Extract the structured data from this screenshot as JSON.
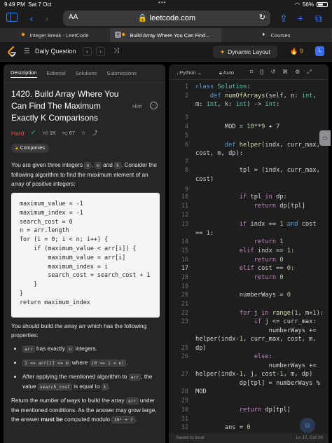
{
  "status_bar": {
    "time": "9:49 PM",
    "date": "Sat 7 Oct",
    "battery": "56%",
    "battery_level": 0.56
  },
  "browser": {
    "aa_label": "AA",
    "url": "leetcode.com",
    "tabs": [
      {
        "title": "Integer Break - LeetCode",
        "active": false
      },
      {
        "title": "Build Array Where You Can Find...",
        "active": true
      },
      {
        "title": "Courses",
        "active": false
      }
    ]
  },
  "lc_nav": {
    "daily_label": "Daily Question",
    "layout_label": "Dynamic Layout",
    "streak": "9"
  },
  "left_panel": {
    "tabs": [
      "Description",
      "Editorial",
      "Solutions",
      "Submissions"
    ],
    "title": "1420. Build Array Where You Can Find The Maximum Exactly K Comparisons",
    "hint": "Hint",
    "difficulty": "Hard",
    "likes": "1K",
    "dislikes": "67",
    "companies": "Companies",
    "intro_1": "You are given three integers",
    "n": "n",
    "m": "m",
    "k": "k",
    "intro_2": ". Consider the following algorithm to find the maximum element of an array of positive integers:",
    "algorithm": [
      "maximum_value = -1",
      "maximum_index = -1",
      "search_cost = 0",
      "n = arr.length",
      "for (i = 0; i < n; i++) {",
      "    if (maximum_value < arr[i]) {",
      "        maximum_value = arr[i]",
      "        maximum_index = i",
      "        search_cost = search_cost + 1",
      "    }",
      "}",
      "return maximum_index"
    ],
    "build_intro": "You should build the array arr which has the following properties:",
    "bullet_1_pre": "",
    "arr": "arr",
    "bullet_1_post": "has exactly",
    "bullet_1_end": "integers.",
    "range_code": "1 <= arr[i] <= m",
    "where": "where",
    "idx_code": "(0 <= i < n)",
    "bullet_3_pre": "After applying the mentioned algorithm to",
    "bullet_3_mid": ", the value",
    "search_cost": "search_cost",
    "bullet_3_end": "is equal to",
    "return_text_1": "Return the",
    "return_italic": "number of ways",
    "return_text_2": "to build the array",
    "return_text_3": "under the mentioned conditions. As the answer may grow large, the answer",
    "must_be": "must be",
    "return_text_4": "computed modulo",
    "modulo": "10⁹ + 7"
  },
  "editor": {
    "language": "Python",
    "auto": "Auto",
    "saved": "Saved to local",
    "cursor": "Ln 17, Col 28",
    "current_line": "17",
    "line_numbers": [
      "1",
      "2",
      "3",
      "4",
      "5",
      "6",
      "7",
      "8",
      "9",
      "10",
      "11",
      "12",
      "13",
      "14",
      "15",
      "16",
      "17",
      "18",
      "19",
      "20",
      "21",
      "22",
      "23",
      "24",
      "25",
      "26",
      "27",
      "28",
      "29",
      "30",
      "31",
      "32",
      "33"
    ]
  }
}
